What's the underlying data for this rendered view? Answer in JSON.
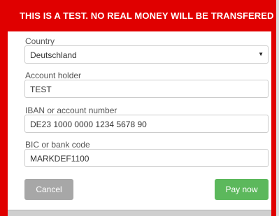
{
  "banner": {
    "text": "THIS IS A TEST. NO REAL MONEY WILL BE TRANSFERED"
  },
  "form": {
    "country": {
      "label": "Country",
      "value": "Deutschland"
    },
    "account_holder": {
      "label": "Account holder",
      "value": "TEST"
    },
    "iban": {
      "label": "IBAN or account number",
      "value": "DE23 1000 0000 1234 5678 90"
    },
    "bic": {
      "label": "BIC or bank code",
      "value": "MARKDEF1100"
    }
  },
  "buttons": {
    "cancel": "Cancel",
    "pay": "Pay now"
  },
  "colors": {
    "banner": "#e00000",
    "pay": "#5cb85c",
    "cancel": "#a7a7a7"
  }
}
